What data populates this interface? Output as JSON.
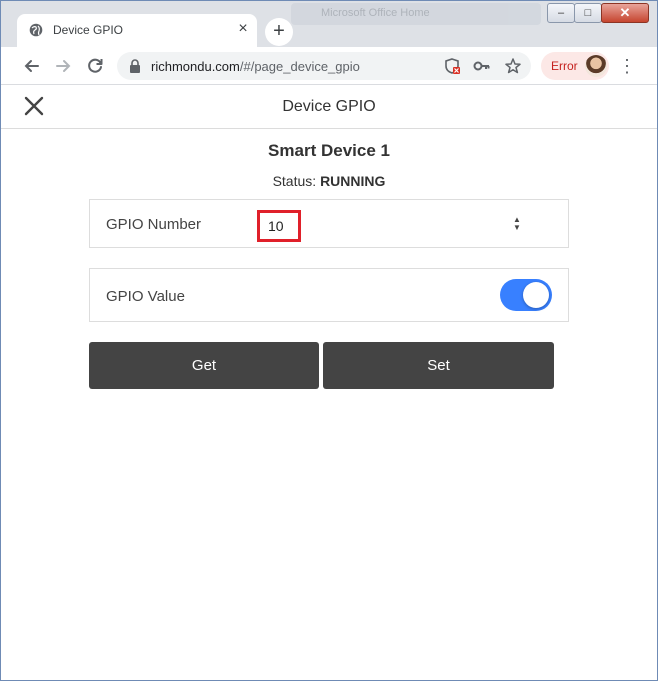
{
  "browser": {
    "tab_title": "Device GPIO",
    "background_tab_title": "Microsoft Office Home",
    "url_host": "richmondu.com",
    "url_path": "/#/page_device_gpio",
    "error_label": "Error",
    "window_controls": {
      "minimize": "–",
      "maximize": "□",
      "close": "✕"
    }
  },
  "icons": {
    "tab": "globe-icon",
    "tab_close": "close-icon",
    "new_tab": "plus-icon",
    "back": "arrow-left-icon",
    "forward": "arrow-right-icon",
    "reload": "reload-icon",
    "lock": "lock-icon",
    "shield": "shield-blocked-icon",
    "key": "key-icon",
    "star": "star-icon",
    "menu": "more-vert-icon",
    "app_close": "close-icon",
    "spinner": "spinner-icon"
  },
  "app": {
    "header_title": "Device GPIO",
    "device_name": "Smart Device 1",
    "status_label": "Status:",
    "status_value": "RUNNING",
    "gpio_number_label": "GPIO Number",
    "gpio_number_value": "10",
    "gpio_value_label": "GPIO Value",
    "gpio_value_on": true,
    "get_label": "Get",
    "set_label": "Set"
  },
  "colors": {
    "toggle_on": "#3880ff",
    "button_bg": "#444444",
    "highlight_border": "#e0202a",
    "error_text": "#c5221f"
  }
}
